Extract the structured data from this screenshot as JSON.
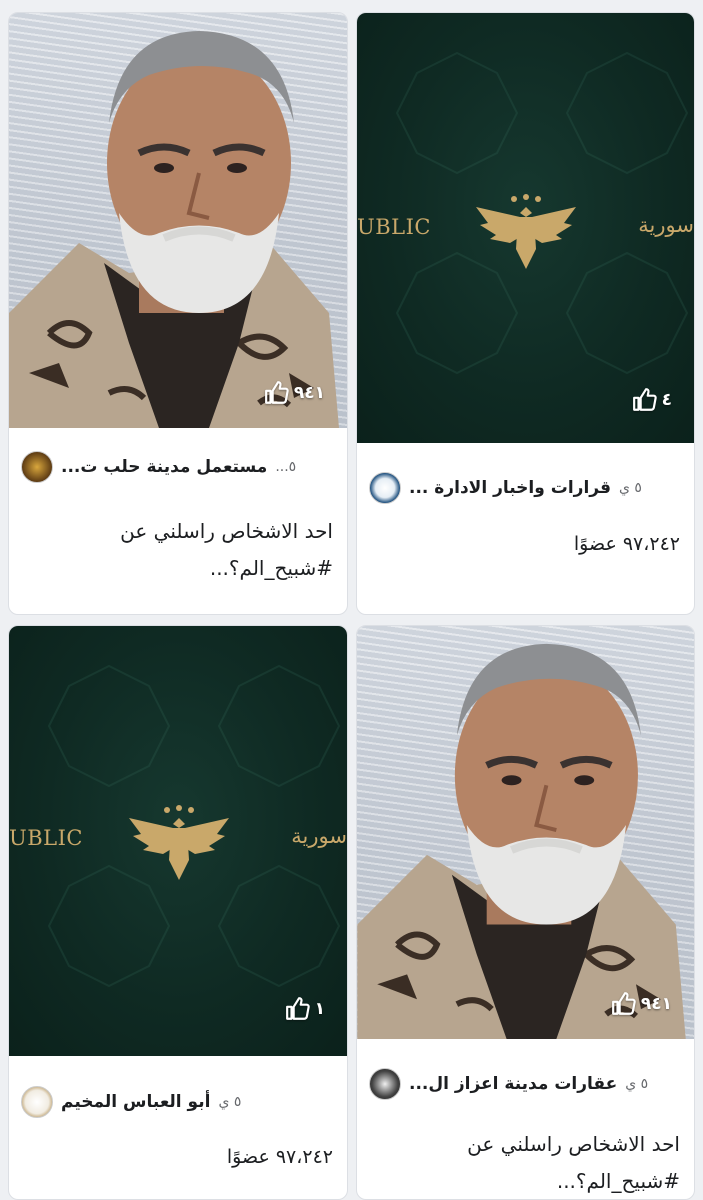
{
  "cards": {
    "tl": {
      "likes": "٩٤١",
      "group_name": "مستعمل مدينة حلب ت...",
      "time": "٥...",
      "text_line1": "احد الاشخاص راسلني عن",
      "text_line2": "#شبيح_الم؟..."
    },
    "tr": {
      "likes": "٤",
      "brand_left": "UBLIC",
      "brand_right": "سورية",
      "group_name": "قرارات واخبار الادارة ...",
      "time": "٥ ي",
      "members": "٩٧،٢٤٢ عضوًا"
    },
    "bl": {
      "likes": "١",
      "brand_left": "UBLIC",
      "brand_right": "سورية",
      "group_name": "أبو العباس المخيم",
      "time": "٥ ي",
      "members": "٩٧،٢٤٢ عضوًا"
    },
    "br": {
      "likes": "٩٤١",
      "group_name": "عقارات مدينة اعزاز ال...",
      "time": "٥ ي",
      "text_line1": "احد الاشخاص راسلني عن",
      "text_line2": "#شبيح_الم؟..."
    }
  },
  "colors": {
    "green_bg": "#0f2a23",
    "gold": "#c9a86a",
    "text": "#1c1e21",
    "muted": "#65676b"
  },
  "icons": {
    "like": "thumbs-up-icon",
    "emblem": "eagle-emblem-icon"
  }
}
